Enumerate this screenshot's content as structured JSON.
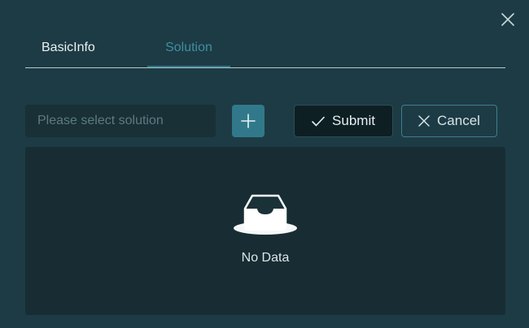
{
  "dialog": {
    "close_icon": "close-icon"
  },
  "tabs": [
    {
      "label": "BasicInfo",
      "active": false
    },
    {
      "label": "Solution",
      "active": true
    }
  ],
  "toolbar": {
    "select_placeholder": "Please select solution",
    "add_icon": "plus-icon",
    "submit_label": "Submit",
    "submit_icon": "check-icon",
    "cancel_label": "Cancel",
    "cancel_icon": "x-icon"
  },
  "table": {
    "empty_text": "No Data",
    "empty_icon": "empty-inbox-icon"
  },
  "colors": {
    "background": "#1d3b45",
    "accent": "#31798a",
    "active_tab": "#3e8f9f",
    "panel": "#172d33"
  }
}
